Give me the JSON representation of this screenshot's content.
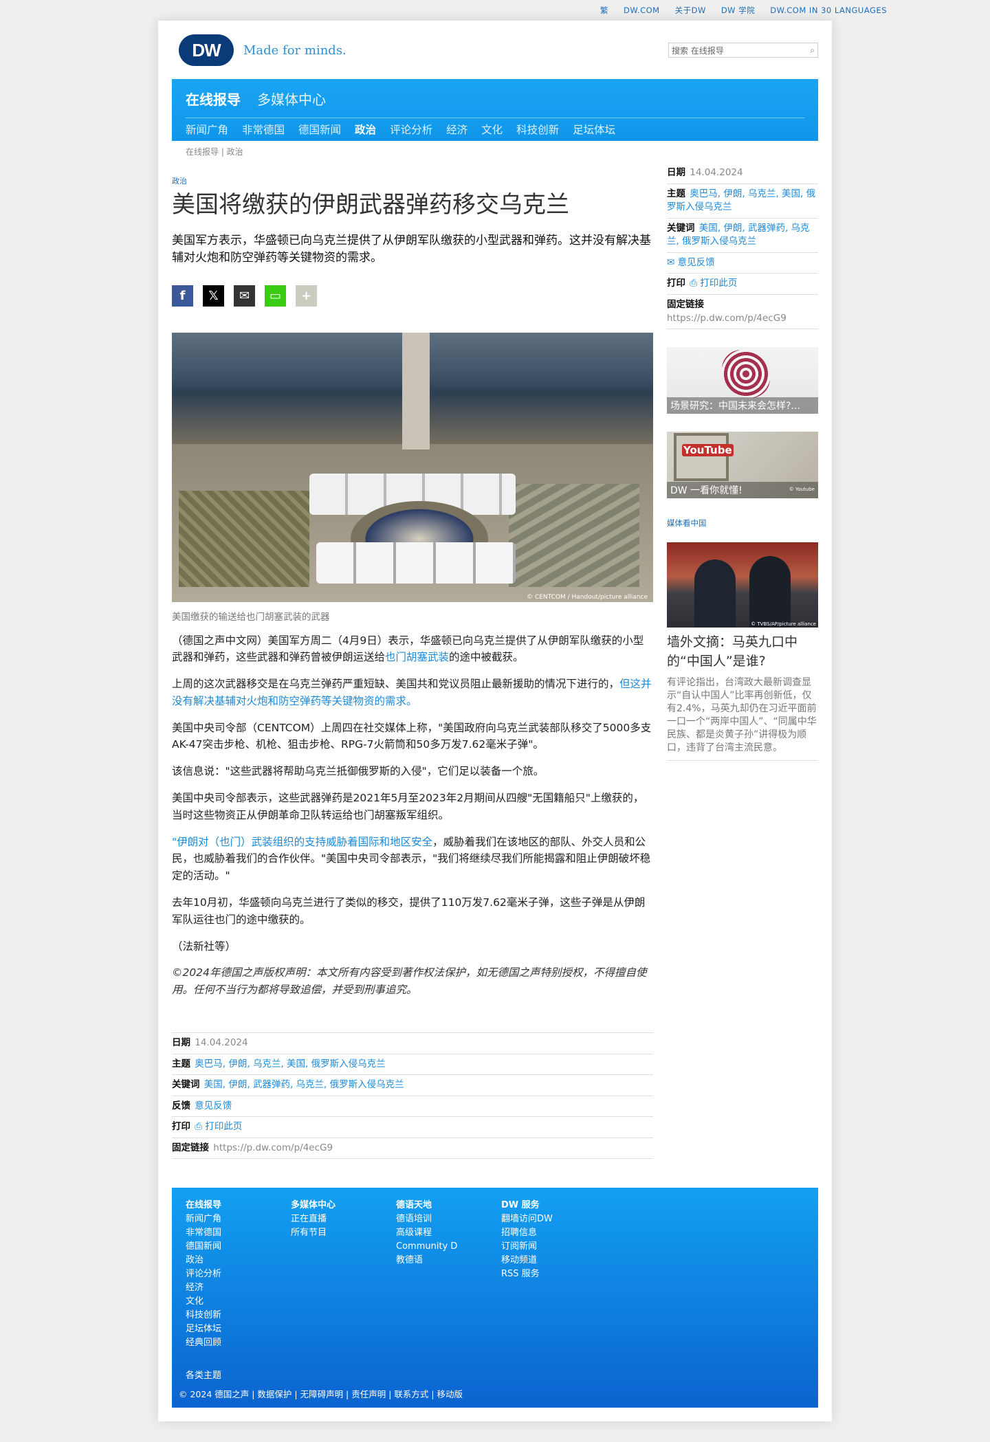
{
  "top_links": [
    "繁",
    "DW.COM",
    "关于DW",
    "DW 学院",
    "DW.COM IN 30 LANGUAGES"
  ],
  "header": {
    "logo_text": "DW",
    "tagline": "Made for minds.",
    "search_placeholder": "搜索 在线报导"
  },
  "nav": {
    "primary": [
      "在线报导",
      "多媒体中心"
    ],
    "secondary": [
      "新闻广角",
      "非常德国",
      "德国新闻",
      "政治",
      "评论分析",
      "经济",
      "文化",
      "科技创新",
      "足坛体坛"
    ],
    "active": "政治"
  },
  "breadcrumb": "在线报导 | 政治",
  "article": {
    "kicker": "政治",
    "title": "美国将缴获的伊朗武器弹药移交乌克兰",
    "lead": "美国军方表示，华盛顿已向乌克兰提供了从伊朗军队缴获的小型武器和弹药。这并没有解决基辅对火炮和防空弹药等关键物资的需求。",
    "image_credit": "© CENTCOM / Handout/picture alliance",
    "caption": "美国缴获的输送给也门胡塞武装的武器",
    "p1_a": "（德国之声中文网）美国军方周二（4月9日）表示，华盛顿已向乌克兰提供了从伊朗军队缴获的小型武器和弹药，这些武器和弹药曾被伊朗运送给",
    "p1_link": "也门胡塞武装",
    "p1_b": "的途中被截获。",
    "p2_a": "上周的这次武器移交是在乌克兰弹药严重短缺、美国共和党议员阻止最新援助的情况下进行的，",
    "p2_link": "但这并没有解决基辅对火炮和防空弹药等关键物资的需求。",
    "p3": "美国中央司令部（CENTCOM）上周四在社交媒体上称，\"美国政府向乌克兰武装部队移交了5000多支AK-47突击步枪、机枪、狙击步枪、RPG-7火箭筒和50多万发7.62毫米子弹\"。",
    "p4": "该信息说：\"这些武器将帮助乌克兰抵御俄罗斯的入侵\"，它们足以装备一个旅。",
    "p5": "美国中央司令部表示，这些武器弹药是2021年5月至2023年2月期间从四艘\"无国籍船只\"上缴获的，当时这些物资正从伊朗革命卫队转运给也门胡塞叛军组织。",
    "p6_link": "\"伊朗对（也门）武装组织的支持威胁着国际和地区安全",
    "p6_b": "，威胁着我们在该地区的部队、外交人员和公民，也威胁着我们的合作伙伴。\"美国中央司令部表示，\"我们将继续尽我们所能揭露和阻止伊朗破坏稳定的活动。\"",
    "p7": "去年10月初，华盛顿向乌克兰进行了类似的移交，提供了110万发7.62毫米子弹，这些子弹是从伊朗军队运往也门的途中缴获的。",
    "p8": "（法新社等）",
    "copyright": "©2024年德国之声版权声明：本文所有内容受到著作权法保护，如无德国之声特别授权，不得擅自使用。任何不当行为都将导致追偿，并受到刑事追究。"
  },
  "meta": {
    "date_label": "日期",
    "date": "14.04.2024",
    "topics_label": "主题",
    "topics": "奥巴马, 伊朗, 乌克兰, 美国, 俄罗斯入侵乌克兰",
    "keywords_label": "关键词",
    "keywords": "美国, 伊朗, 武器弹药, 乌克兰, 俄罗斯入侵乌克兰",
    "feedback_label": "反馈",
    "feedback": "意见反馈",
    "print_label": "打印",
    "print": "打印此页",
    "permalink_label": "固定链接",
    "permalink": "https://p.dw.com/p/4ecG9"
  },
  "sidebar": {
    "card1": "场景研究：中国未来会怎样?...",
    "card2": "DW 一看你就懂!",
    "card2_credit": "© Youtube",
    "youtube_text": "YouTube",
    "kicker": "媒体看中国",
    "card3_credit": "© TVBS/AP/picture alliance",
    "feature_title": "墙外文摘：马英九口中的“中国人”是谁?",
    "feature_text": "有评论指出，台湾政大最新调查显示“自认中国人”比率再创新低，仅有2.4%，马英九却仍在习近平面前一口一个“两岸中国人”、“同属中华民族、都是炎黄子孙”讲得极为顺口，违背了台湾主流民意。"
  },
  "footer": {
    "col1_head": "在线报导",
    "col1": [
      "新闻广角",
      "非常德国",
      "德国新闻",
      "政治",
      "评论分析",
      "经济",
      "文化",
      "科技创新",
      "足坛体坛",
      "经典回顾"
    ],
    "col2_head": "多媒体中心",
    "col2": [
      "正在直播",
      "所有节目"
    ],
    "col3_head": "德语天地",
    "col3": [
      "德语培训",
      "高级课程",
      "Community D",
      "教德语"
    ],
    "col4_head": "DW 服务",
    "col4": [
      "翻墙访问DW",
      "招聘信息",
      "订阅新闻",
      "移动频道",
      "RSS 服务"
    ],
    "misc": "各类主题",
    "copyright": "© 2024 德国之声 | 数据保护 | 无障碍声明 | 责任声明 | 联系方式 | 移动版"
  },
  "colors": {
    "nav_blue": "#1aa5f3",
    "link_blue": "#1c8ad8",
    "dw_navy": "#0a3a77"
  }
}
